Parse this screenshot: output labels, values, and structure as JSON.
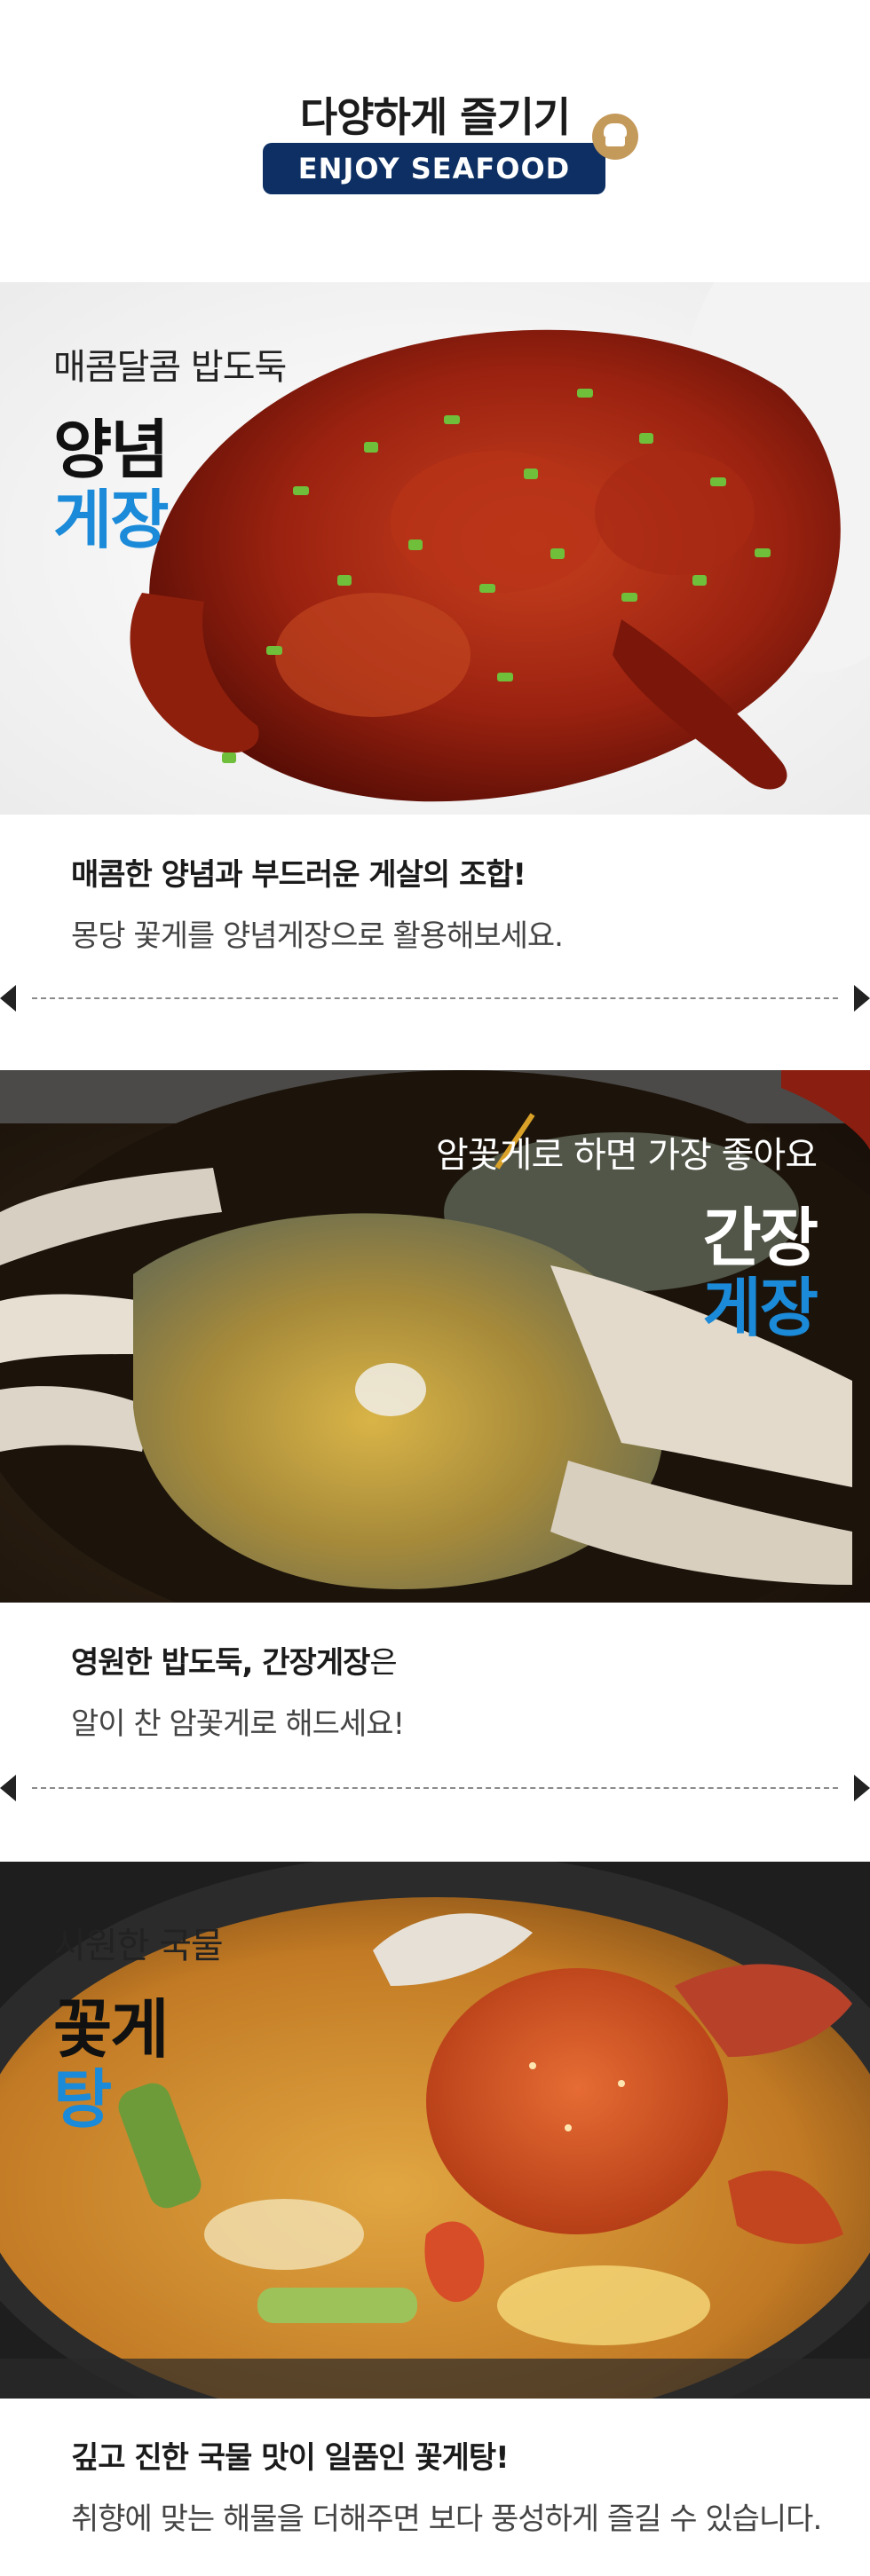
{
  "header": {
    "title": "다양하게 즐기기",
    "badge": "ENJOY SEAFOOD",
    "icon": "chef-hat-icon"
  },
  "sections": [
    {
      "subtitle": "매콤달콤 밥도둑",
      "name_line1": "양념",
      "name_line2": "게장",
      "caption_bold": "매콤한 양념과 부드러운 게살의 조합!",
      "caption": "몽당 꽃게를 양념게장으로 활용해보세요."
    },
    {
      "subtitle": "암꽃게로 하면 가장 좋아요",
      "name_line1": "간장",
      "name_line2": "게장",
      "caption_bold": "영원한 밥도둑, 간장게장",
      "caption_bold_suffix": "은",
      "caption": "알이 찬 암꽃게로 해드세요!"
    },
    {
      "subtitle": "시원한 국물",
      "name_line1": "꽃게",
      "name_line2": "탕",
      "caption_bold": "깊고 진한 국물 맛이 일품인 꽃게탕!",
      "caption": "취향에 맞는 해물을 더해주면 보다 풍성하게 즐길 수 있습니다."
    }
  ],
  "colors": {
    "badge_bg": "#0d2f63",
    "accent_blue": "#1b8ad8",
    "chef_icon_bg": "#c49a5b"
  }
}
